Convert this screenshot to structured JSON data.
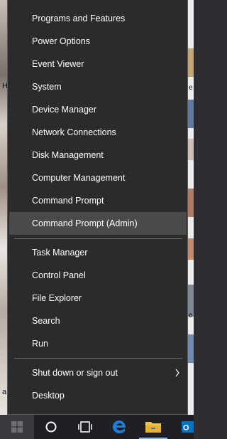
{
  "menu": {
    "items": [
      {
        "label": "Programs and Features"
      },
      {
        "label": "Power Options"
      },
      {
        "label": "Event Viewer"
      },
      {
        "label": "System"
      },
      {
        "label": "Device Manager"
      },
      {
        "label": "Network Connections"
      },
      {
        "label": "Disk Management"
      },
      {
        "label": "Computer Management"
      },
      {
        "label": "Command Prompt"
      },
      {
        "label": "Command Prompt (Admin)"
      },
      {
        "label": "Task Manager"
      },
      {
        "label": "Control Panel"
      },
      {
        "label": "File Explorer"
      },
      {
        "label": "Search"
      },
      {
        "label": "Run"
      },
      {
        "label": "Shut down or sign out"
      },
      {
        "label": "Desktop"
      }
    ],
    "highlighted_item": "Command Prompt (Admin)"
  },
  "taskbar": {
    "buttons": [
      "windows-start-icon",
      "cortana-search-icon",
      "task-view-icon",
      "edge-browser-icon",
      "file-explorer-icon",
      "outlook-icon"
    ]
  },
  "colors": {
    "menu_bg": "#2b2b2b",
    "highlight_bg": "#4a4a4a",
    "text": "#ffffff",
    "taskbar_bg": "#1f1f24",
    "edge_blue": "#1e7fd6",
    "outlook_blue": "#0072c6",
    "folder_yellow": "#f0c24a"
  }
}
